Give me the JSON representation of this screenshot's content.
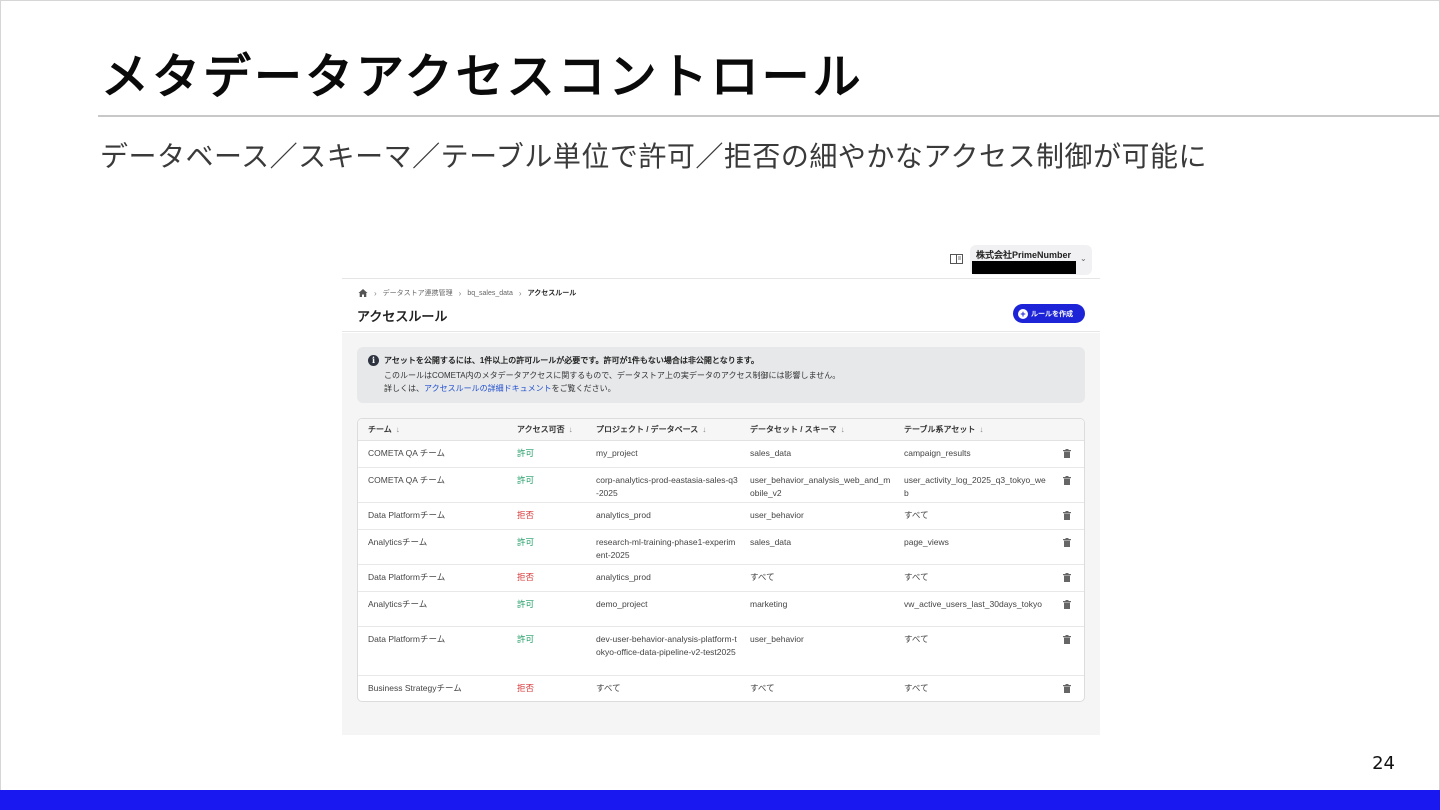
{
  "slide": {
    "title": "メタデータアクセスコントロール",
    "subtitle": "データベース／スキーマ／テーブル単位で許可／拒否の細やかなアクセス制御が可能に",
    "page_number": "24",
    "accent_color": "#1a18f0"
  },
  "app": {
    "org_name": "株式会社PrimeNumber",
    "breadcrumb": [
      "データストア連携管理",
      "bq_sales_data",
      "アクセスルール"
    ],
    "page_heading": "アクセスルール",
    "create_button": "ルールを作成",
    "info": {
      "line1": "アセットを公開するには、1件以上の許可ルールが必要です。許可が1件もない場合は非公開となります。",
      "line2": "このルールはCOMETA内のメタデータアクセスに関するもので、データストア上の実データのアクセス制御には影響しません。",
      "line3_prefix": "詳しくは、",
      "line3_link": "アクセスルールの詳細ドキュメント",
      "line3_suffix": "をご覧ください。"
    },
    "table": {
      "columns": [
        "チーム",
        "アクセス可否",
        "プロジェクト / データベース",
        "データセット / スキーマ",
        "テーブル系アセット"
      ],
      "rows": [
        {
          "team": "COMETA QA チーム",
          "access": "許可",
          "project": "my_project",
          "dataset": "sales_data",
          "table": "campaign_results"
        },
        {
          "team": "COMETA QA チーム",
          "access": "許可",
          "project": "corp-analytics-prod-eastasia-sales-q3-2025",
          "dataset": "user_behavior_analysis_web_and_mobile_v2",
          "table": "user_activity_log_2025_q3_tokyo_web"
        },
        {
          "team": "Data Platformチーム",
          "access": "拒否",
          "project": "analytics_prod",
          "dataset": "user_behavior",
          "table": "すべて"
        },
        {
          "team": "Analyticsチーム",
          "access": "許可",
          "project": "research-ml-training-phase1-experiment-2025",
          "dataset": "sales_data",
          "table": "page_views"
        },
        {
          "team": "Data Platformチーム",
          "access": "拒否",
          "project": "analytics_prod",
          "dataset": "すべて",
          "table": "すべて"
        },
        {
          "team": "Analyticsチーム",
          "access": "許可",
          "project": "demo_project",
          "dataset": "marketing",
          "table": "vw_active_users_last_30days_tokyo"
        },
        {
          "team": "Data Platformチーム",
          "access": "許可",
          "project": "dev-user-behavior-analysis-platform-tokyo-office-data-pipeline-v2-test2025",
          "dataset": "user_behavior",
          "table": "すべて"
        },
        {
          "team": "Business Strategyチーム",
          "access": "拒否",
          "project": "すべて",
          "dataset": "すべて",
          "table": "すべて"
        }
      ]
    }
  }
}
